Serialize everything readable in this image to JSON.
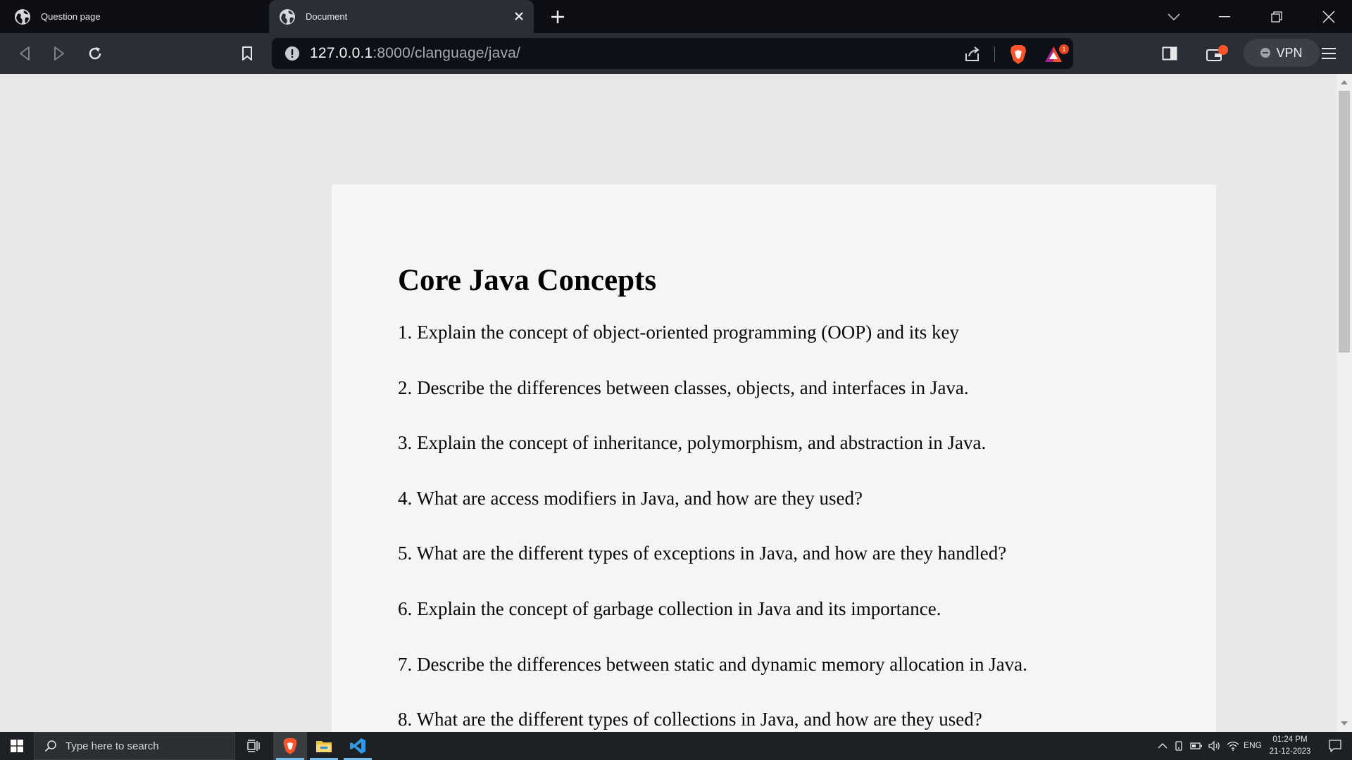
{
  "browser": {
    "tabs": [
      {
        "title": "Question page",
        "icon": "globe-icon",
        "active": false
      },
      {
        "title": "Document",
        "icon": "globe-icon",
        "active": true
      }
    ],
    "url": {
      "host": "127.0.0.1",
      "rest": ":8000/clanguage/java/"
    },
    "vpn_label": "VPN",
    "rewards_badge": "1"
  },
  "page": {
    "title": "Core Java Concepts",
    "questions": [
      "1. Explain the concept of object-oriented programming (OOP) and its key",
      "2. Describe the differences between classes, objects, and interfaces in Java.",
      "3. Explain the concept of inheritance, polymorphism, and abstraction in Java.",
      "4. What are access modifiers in Java, and how are they used?",
      "5. What are the different types of exceptions in Java, and how are they handled?",
      "6. Explain the concept of garbage collection in Java and its importance.",
      "7. Describe the differences between static and dynamic memory allocation in Java.",
      "8. What are the different types of collections in Java, and how are they used?"
    ]
  },
  "taskbar": {
    "search_placeholder": "Type here to search",
    "language": "ENG",
    "time": "01:24 PM",
    "date": "21-12-2023"
  },
  "colors": {
    "tab_bg": "#0c0e13",
    "toolbar_bg": "#2a2e36",
    "page_bg": "#e8e8e8",
    "card_bg": "#f5f4f7",
    "brave_orange": "#fb542b",
    "taskbar_bg": "#1d2025",
    "taskbar_accent": "#76b9ed"
  }
}
